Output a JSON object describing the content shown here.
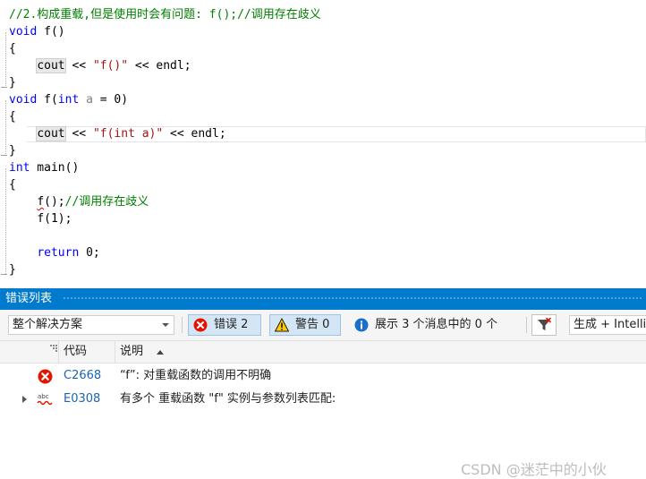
{
  "editor": {
    "line1_comment": "//2.构成重载,但是使用时会有问题: f();//调用存在歧义",
    "fn1": {
      "kw": "void",
      "name": " f()",
      "cout": "cout",
      "op1": " << ",
      "str": "\"f()\"",
      "op2": " << ",
      "endl": "endl;"
    },
    "fn2": {
      "kw": "void",
      "name_open": " f(",
      "ptype": "int",
      "pname": " a",
      "tail": " = 0)",
      "cout": "cout",
      "op1": " << ",
      "str": "\"f(int a)\"",
      "op2": " << ",
      "endl": "endl;"
    },
    "main": {
      "kw": "int",
      "name": " main()",
      "call1": "f",
      "call1_rest": "();",
      "call1_comment": "//调用存在歧义",
      "call2": "f(1);",
      "ret_kw": "return",
      "ret_rest": " 0;"
    },
    "brace_open": "{",
    "brace_close": "}"
  },
  "error_list": {
    "title": "错误列表",
    "scope_value": "整个解决方案",
    "errors_label": "错误 2",
    "warnings_label": "警告 0",
    "messages_label": "展示 3 个消息中的 0 个",
    "build_value": "生成 + IntelliSense",
    "columns": {
      "code": "代码",
      "description": "说明"
    },
    "rows": [
      {
        "icon": "error-x-icon",
        "code": "C2668",
        "description": "“f”: 对重载函数的调用不明确"
      },
      {
        "icon": "intellisense-squiggle-icon",
        "code": "E0308",
        "description": "有多个 重载函数 \"f\" 实例与参数列表匹配:"
      }
    ]
  },
  "watermark": "CSDN @迷茫中的小伙",
  "colors": {
    "accent": "#007acc",
    "keyword": "#0000ff",
    "comment": "#008000",
    "string": "#a31515",
    "error": "#e51400"
  }
}
